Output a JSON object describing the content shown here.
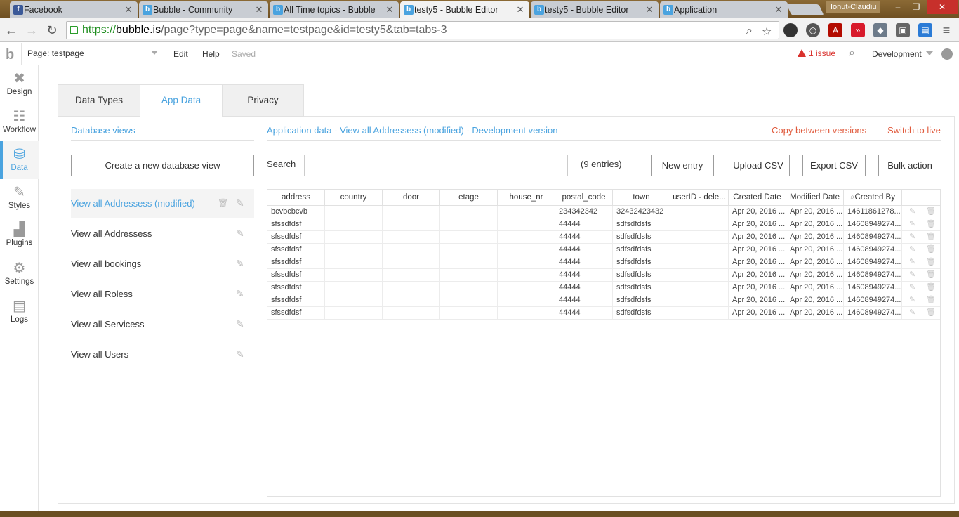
{
  "browser": {
    "tabs": [
      {
        "title": "Facebook",
        "icon": "facebook-icon"
      },
      {
        "title": "Bubble - Community",
        "icon": "bubble-icon"
      },
      {
        "title": "All Time topics - Bubble",
        "icon": "bubble-icon"
      },
      {
        "title": "testy5 - Bubble Editor",
        "icon": "bubble-icon",
        "active": true
      },
      {
        "title": "testy5 - Bubble Editor",
        "icon": "bubble-icon"
      },
      {
        "title": "Application",
        "icon": "bubble-icon"
      }
    ],
    "user": "Ionut-Claudiu",
    "url": {
      "scheme": "https://",
      "host": "bubble.is",
      "path": "/page?type=page&name=testpage&id=testy5&tab=tabs-3"
    }
  },
  "header": {
    "page_selector": "Page: testpage",
    "menu_edit": "Edit",
    "menu_help": "Help",
    "status": "Saved",
    "issues": "1 issue",
    "environment": "Development"
  },
  "sidebar": {
    "items": [
      {
        "label": "Design",
        "icon": "design-icon"
      },
      {
        "label": "Workflow",
        "icon": "workflow-icon"
      },
      {
        "label": "Data",
        "icon": "database-icon",
        "active": true
      },
      {
        "label": "Styles",
        "icon": "brush-icon"
      },
      {
        "label": "Plugins",
        "icon": "plugin-icon"
      },
      {
        "label": "Settings",
        "icon": "gear-icon"
      },
      {
        "label": "Logs",
        "icon": "document-icon"
      }
    ]
  },
  "tabs": [
    {
      "label": "Data Types"
    },
    {
      "label": "App Data",
      "active": true
    },
    {
      "label": "Privacy"
    }
  ],
  "views": {
    "title": "Database views",
    "create_button": "Create a new database view",
    "items": [
      {
        "label": "View all Addressess (modified)",
        "active": true
      },
      {
        "label": "View all Addressess"
      },
      {
        "label": "View all bookings"
      },
      {
        "label": "View all Roless"
      },
      {
        "label": "View all Servicess"
      },
      {
        "label": "View all Users"
      }
    ]
  },
  "app_data": {
    "title": "Application data - View all Addressess (modified) - Development version",
    "copy_link": "Copy between versions",
    "switch_link": "Switch to live",
    "search_label": "Search",
    "search_value": "",
    "entries": "(9 entries)",
    "buttons": {
      "new_entry": "New entry",
      "upload_csv": "Upload CSV",
      "export_csv": "Export CSV",
      "bulk_action": "Bulk action"
    },
    "columns": [
      "address",
      "country",
      "door",
      "etage",
      "house_nr",
      "postal_code",
      "town",
      "userID - dele...",
      "Created Date",
      "Modified Date",
      "Created By"
    ],
    "rows": [
      [
        "bcvbcbcvb",
        "",
        "",
        "",
        "",
        "234342342",
        "32432423432",
        "",
        "Apr 20, 2016 ...",
        "Apr 20, 2016 ...",
        "14611861278..."
      ],
      [
        "sfssdfdsf",
        "",
        "",
        "",
        "",
        "44444",
        "sdfsdfdsfs",
        "",
        "Apr 20, 2016 ...",
        "Apr 20, 2016 ...",
        "14608949274..."
      ],
      [
        "sfssdfdsf",
        "",
        "",
        "",
        "",
        "44444",
        "sdfsdfdsfs",
        "",
        "Apr 20, 2016 ...",
        "Apr 20, 2016 ...",
        "14608949274..."
      ],
      [
        "sfssdfdsf",
        "",
        "",
        "",
        "",
        "44444",
        "sdfsdfdsfs",
        "",
        "Apr 20, 2016 ...",
        "Apr 20, 2016 ...",
        "14608949274..."
      ],
      [
        "sfssdfdsf",
        "",
        "",
        "",
        "",
        "44444",
        "sdfsdfdsfs",
        "",
        "Apr 20, 2016 ...",
        "Apr 20, 2016 ...",
        "14608949274..."
      ],
      [
        "sfssdfdsf",
        "",
        "",
        "",
        "",
        "44444",
        "sdfsdfdsfs",
        "",
        "Apr 20, 2016 ...",
        "Apr 20, 2016 ...",
        "14608949274..."
      ],
      [
        "sfssdfdsf",
        "",
        "",
        "",
        "",
        "44444",
        "sdfsdfdsfs",
        "",
        "Apr 20, 2016 ...",
        "Apr 20, 2016 ...",
        "14608949274..."
      ],
      [
        "sfssdfdsf",
        "",
        "",
        "",
        "",
        "44444",
        "sdfsdfdsfs",
        "",
        "Apr 20, 2016 ...",
        "Apr 20, 2016 ...",
        "14608949274..."
      ],
      [
        "sfssdfdsf",
        "",
        "",
        "",
        "",
        "44444",
        "sdfsdfdsfs",
        "",
        "Apr 20, 2016 ...",
        "Apr 20, 2016 ...",
        "14608949274..."
      ]
    ]
  },
  "colors": {
    "accent": "#4aa3df",
    "link_red": "#e05a3c",
    "issue_red": "#d9322e"
  }
}
